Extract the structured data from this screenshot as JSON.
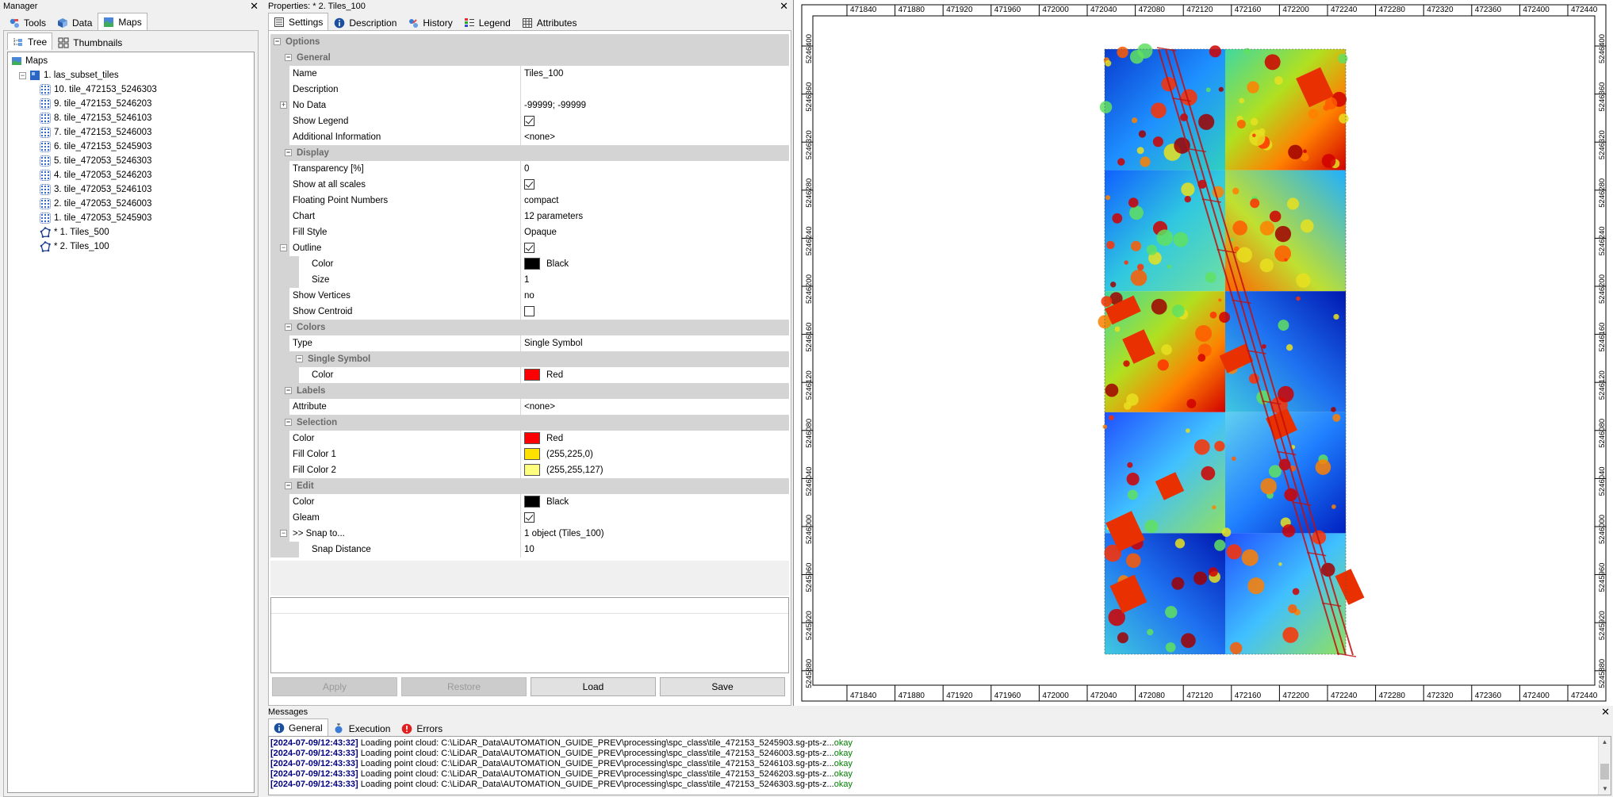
{
  "manager": {
    "title": "Manager",
    "tabs": [
      "Tools",
      "Data",
      "Maps"
    ],
    "subtabs": [
      "Tree",
      "Thumbnails"
    ],
    "tree": {
      "root": "Maps",
      "map": "1. las_subset_tiles",
      "layers": [
        "10. tile_472153_5246303",
        "9. tile_472153_5246203",
        "8. tile_472153_5246103",
        "7. tile_472153_5246003",
        "6. tile_472153_5245903",
        "5. tile_472053_5246303",
        "4. tile_472053_5246203",
        "3. tile_472053_5246103",
        "2. tile_472053_5246003",
        "1. tile_472053_5245903",
        "* 1. Tiles_500",
        "* 2. Tiles_100"
      ]
    }
  },
  "properties": {
    "title": "Properties: * 2. Tiles_100",
    "tabs": [
      "Settings",
      "Description",
      "History",
      "Legend",
      "Attributes"
    ],
    "rows": [
      {
        "type": "cat",
        "level": 0,
        "label": "Options"
      },
      {
        "type": "cat",
        "level": 1,
        "label": "General"
      },
      {
        "type": "prop",
        "level": 1,
        "key": "Name",
        "value": "Tiles_100"
      },
      {
        "type": "prop",
        "level": 1,
        "key": "Description",
        "value": ""
      },
      {
        "type": "prop",
        "level": 1,
        "key": "No Data",
        "value": "-99999; -99999",
        "expander": true
      },
      {
        "type": "check",
        "level": 1,
        "key": "Show Legend",
        "checked": true
      },
      {
        "type": "prop",
        "level": 1,
        "key": "Additional Information",
        "value": "<none>"
      },
      {
        "type": "cat",
        "level": 1,
        "label": "Display"
      },
      {
        "type": "prop",
        "level": 1,
        "key": "Transparency [%]",
        "value": "0"
      },
      {
        "type": "check",
        "level": 1,
        "key": "Show at all scales",
        "checked": true
      },
      {
        "type": "prop",
        "level": 1,
        "key": "Floating Point Numbers",
        "value": "compact"
      },
      {
        "type": "prop",
        "level": 1,
        "key": "Chart",
        "value": "12 parameters"
      },
      {
        "type": "prop",
        "level": 1,
        "key": "Fill Style",
        "value": "Opaque"
      },
      {
        "type": "check",
        "level": 1,
        "key": "Outline",
        "checked": true,
        "expander": true
      },
      {
        "type": "color",
        "level": 2,
        "key": "Color",
        "value": "Black",
        "color": "#000000"
      },
      {
        "type": "prop",
        "level": 2,
        "key": "Size",
        "value": "1"
      },
      {
        "type": "prop",
        "level": 1,
        "key": "Show Vertices",
        "value": "no"
      },
      {
        "type": "check",
        "level": 1,
        "key": "Show Centroid",
        "checked": false
      },
      {
        "type": "cat",
        "level": 1,
        "label": "Colors"
      },
      {
        "type": "prop",
        "level": 1,
        "key": "Type",
        "value": "Single Symbol"
      },
      {
        "type": "cat",
        "level": 2,
        "label": "Single Symbol"
      },
      {
        "type": "color",
        "level": 2,
        "key": "Color",
        "value": "Red",
        "color": "#ff0000"
      },
      {
        "type": "cat",
        "level": 1,
        "label": "Labels"
      },
      {
        "type": "prop",
        "level": 1,
        "key": "Attribute",
        "value": "<none>"
      },
      {
        "type": "cat",
        "level": 1,
        "label": "Selection"
      },
      {
        "type": "color",
        "level": 1,
        "key": "Color",
        "value": "Red",
        "color": "#ff0000"
      },
      {
        "type": "color",
        "level": 1,
        "key": "Fill Color 1",
        "value": "(255,225,0)",
        "color": "#ffe100"
      },
      {
        "type": "color",
        "level": 1,
        "key": "Fill Color 2",
        "value": "(255,255,127)",
        "color": "#ffff7f"
      },
      {
        "type": "cat",
        "level": 1,
        "label": "Edit"
      },
      {
        "type": "color",
        "level": 1,
        "key": "Color",
        "value": "Black",
        "color": "#000000"
      },
      {
        "type": "check",
        "level": 1,
        "key": "Gleam",
        "checked": true
      },
      {
        "type": "prop",
        "level": 1,
        "key": ">> Snap to...",
        "value": "1 object (Tiles_100)",
        "expander": true
      },
      {
        "type": "prop",
        "level": 2,
        "key": "Snap Distance",
        "value": "10"
      }
    ],
    "buttons": {
      "apply": "Apply",
      "restore": "Restore",
      "load": "Load",
      "save": "Save"
    }
  },
  "map": {
    "x_ticks": [
      "471840",
      "471880",
      "471920",
      "471960",
      "472000",
      "472040",
      "472080",
      "472120",
      "472160",
      "472200",
      "472240",
      "472280",
      "472320",
      "472360",
      "472400",
      "472440"
    ],
    "y_ticks": [
      "5246400",
      "5246360",
      "5246320",
      "5246280",
      "5246240",
      "5246200",
      "5246160",
      "5246120",
      "5246080",
      "5246040",
      "5246000",
      "5245960",
      "5245920",
      "5245880"
    ]
  },
  "messages": {
    "title": "Messages",
    "tabs": [
      "General",
      "Execution",
      "Errors"
    ],
    "lines": [
      {
        "ts": "[2024-07-09/12:43:32]",
        "text": " Loading point cloud: C:\\LiDAR_Data\\AUTOMATION_GUIDE_PREV\\processing\\spc_class\\tile_472153_5245903.sg-pts-z...",
        "status": "okay"
      },
      {
        "ts": "[2024-07-09/12:43:33]",
        "text": " Loading point cloud: C:\\LiDAR_Data\\AUTOMATION_GUIDE_PREV\\processing\\spc_class\\tile_472153_5246003.sg-pts-z...",
        "status": "okay"
      },
      {
        "ts": "[2024-07-09/12:43:33]",
        "text": " Loading point cloud: C:\\LiDAR_Data\\AUTOMATION_GUIDE_PREV\\processing\\spc_class\\tile_472153_5246103.sg-pts-z...",
        "status": "okay"
      },
      {
        "ts": "[2024-07-09/12:43:33]",
        "text": " Loading point cloud: C:\\LiDAR_Data\\AUTOMATION_GUIDE_PREV\\processing\\spc_class\\tile_472153_5246203.sg-pts-z...",
        "status": "okay"
      },
      {
        "ts": "[2024-07-09/12:43:33]",
        "text": " Loading point cloud: C:\\LiDAR_Data\\AUTOMATION_GUIDE_PREV\\processing\\spc_class\\tile_472153_5246303.sg-pts-z...",
        "status": "okay"
      }
    ]
  },
  "colors": {
    "accent": "#2a5ec5",
    "selection": "#ff0000",
    "info_blue": "#1c5fb8",
    "error_red": "#e02020"
  }
}
